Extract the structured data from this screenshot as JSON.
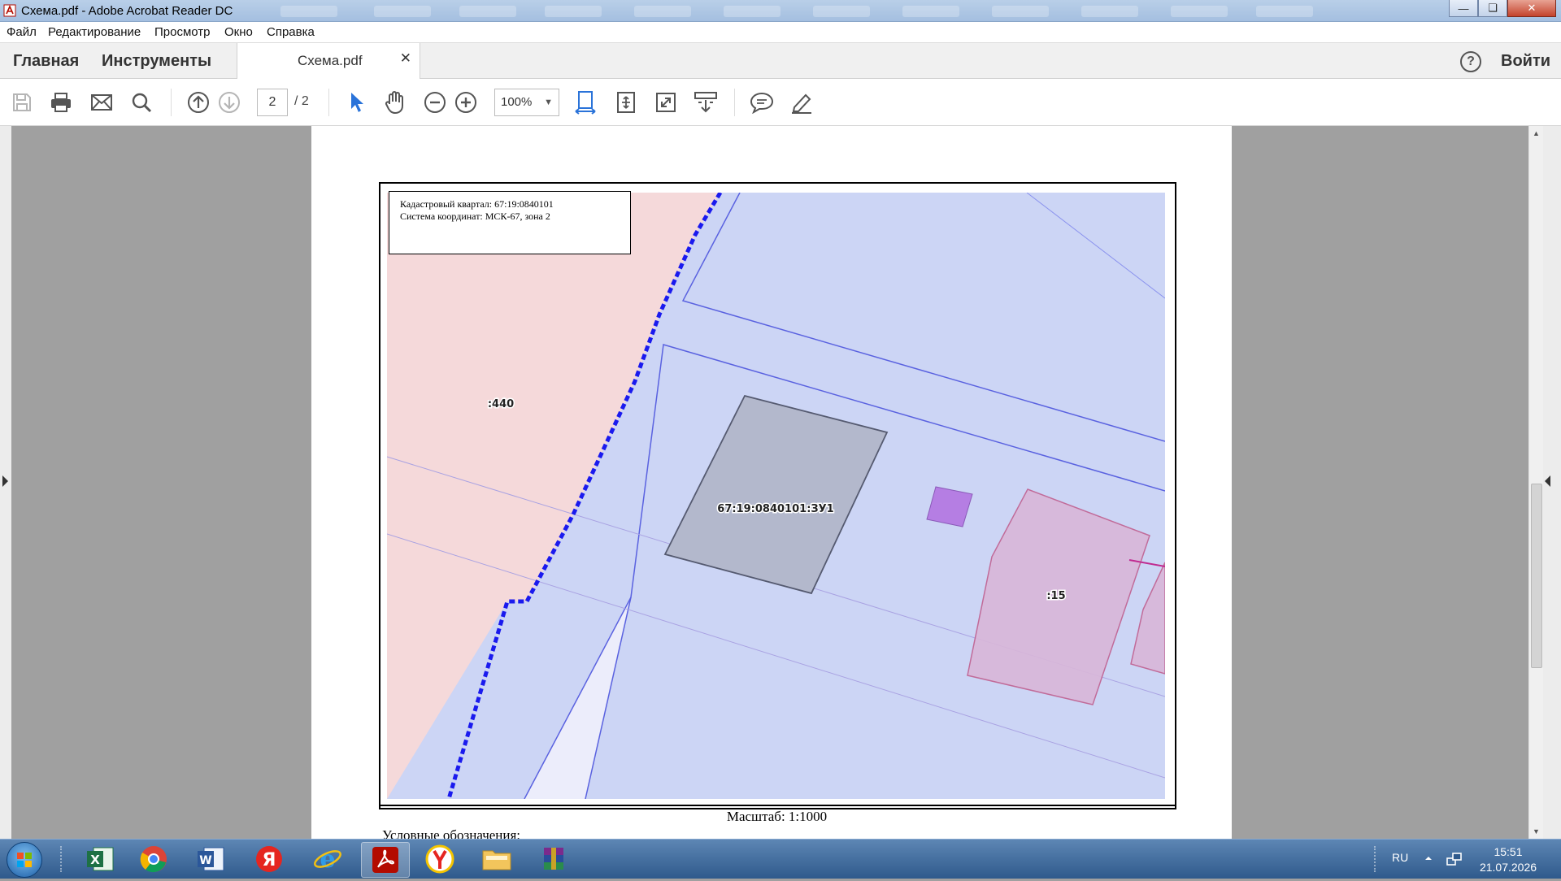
{
  "window": {
    "title": "Схема.pdf - Adobe Acrobat Reader DC"
  },
  "menu": [
    "Файл",
    "Редактирование",
    "Просмотр",
    "Окно",
    "Справка"
  ],
  "tabs": {
    "home": "Главная",
    "tools": "Инструменты",
    "document": "Схема.pdf",
    "sign_in": "Войти"
  },
  "toolbar": {
    "current_page": "2",
    "page_total": "/ 2",
    "zoom": "100%"
  },
  "document": {
    "info_line1": "Кадастровый квартал: 67:19:0840101",
    "info_line2": "Система координат: МСК-67, зона 2",
    "parcel_main": "67:19:0840101:ЗУ1",
    "parcel_440": ":440",
    "parcel_15": ":15",
    "scale": "Масштаб: 1:1000",
    "legend": "Условные обозначения:"
  },
  "tray": {
    "lang": "RU",
    "time": "15:51",
    "date": "21.07.2026"
  },
  "colors": {
    "map_blue": "#ccd5f5",
    "map_pink": "#f5d9da",
    "boundary": "#1a1aee",
    "parcel_gray": "#b3b8cc",
    "parcel_15": "#d9b7d9"
  }
}
